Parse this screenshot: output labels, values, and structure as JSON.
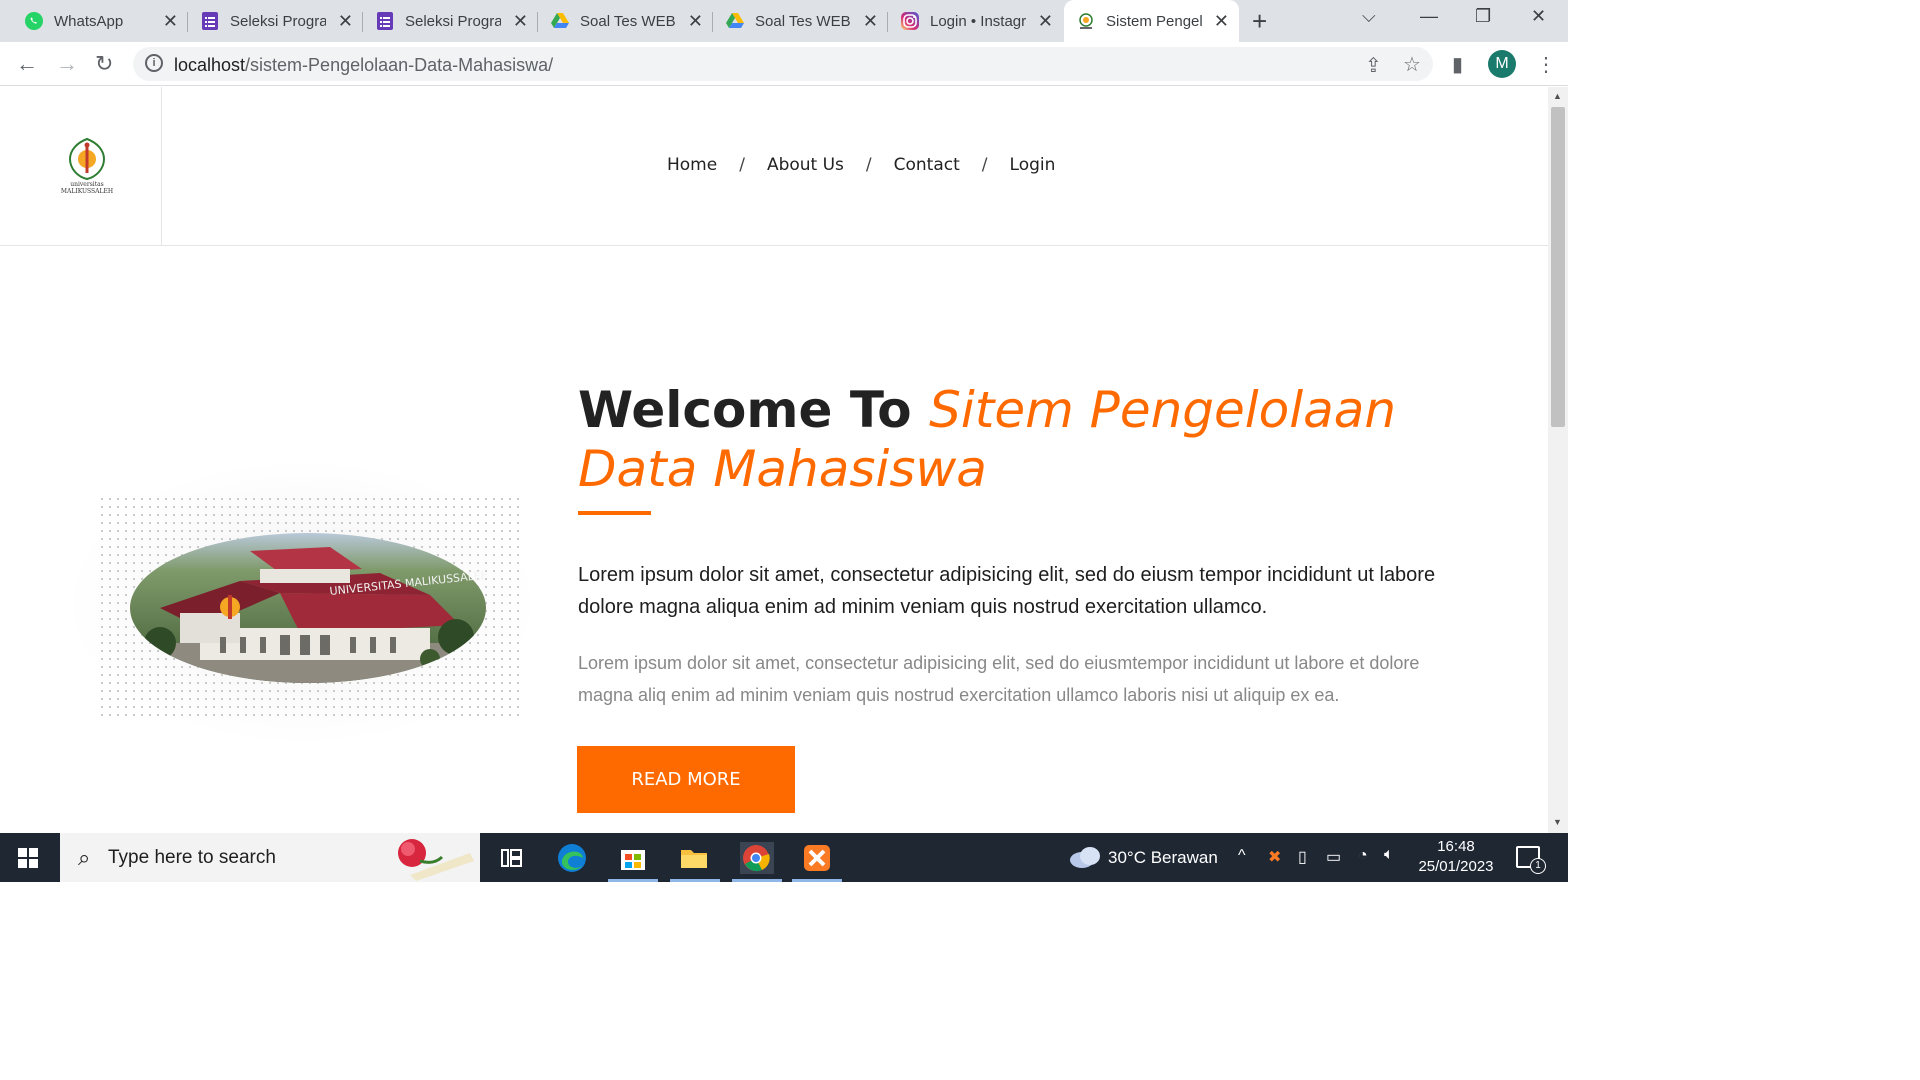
{
  "browser": {
    "tabs": [
      {
        "title": "WhatsApp",
        "icon": "whatsapp-icon"
      },
      {
        "title": "Seleksi Program",
        "icon": "forms-icon"
      },
      {
        "title": "Seleksi Program",
        "icon": "forms-icon"
      },
      {
        "title": "Soal Tes WEB D",
        "icon": "drive-icon"
      },
      {
        "title": "Soal Tes WEB D",
        "icon": "drive-icon"
      },
      {
        "title": "Login • Instagram",
        "icon": "instagram-icon"
      },
      {
        "title": "Sistem Pengelolaan",
        "icon": "university-logo-icon",
        "active": true
      }
    ],
    "new_tab": "+",
    "address": {
      "host": "localhost",
      "path": "/sistem-Pengelolaan-Data-Mahasiswa/"
    },
    "profile_initial": "M"
  },
  "site": {
    "logo_text": "universitas MALIKUSSALEH",
    "nav": [
      {
        "label": "Home"
      },
      {
        "label": "About Us"
      },
      {
        "label": "Contact"
      },
      {
        "label": "Login"
      }
    ],
    "nav_separator": "/",
    "hero": {
      "headline_plain": "Welcome To",
      "headline_accent": "Sitem Pengelolaan Data Mahasiswa",
      "lead": "Lorem ipsum dolor sit amet, consectetur adipisicing elit, sed do eiusm tempor incididunt ut labore dolore magna aliqua enim ad minim veniam quis nostrud exercitation ullamco.",
      "body": "Lorem ipsum dolor sit amet, consectetur adipisicing elit, sed do eiusmtempor incididunt ut labore et dolore magna aliq enim ad minim veniam quis nostrud exercitation ullamco laboris nisi ut aliquip ex ea.",
      "button_label": "READ MORE",
      "image_caption": "UNIVERSITAS MALIKUSSALEH"
    },
    "accent_color": "#ff6a00"
  },
  "taskbar": {
    "search_placeholder": "Type here to search",
    "weather": "30°C  Berawan",
    "time": "16:48",
    "date": "25/01/2023",
    "notification_count": "1"
  }
}
